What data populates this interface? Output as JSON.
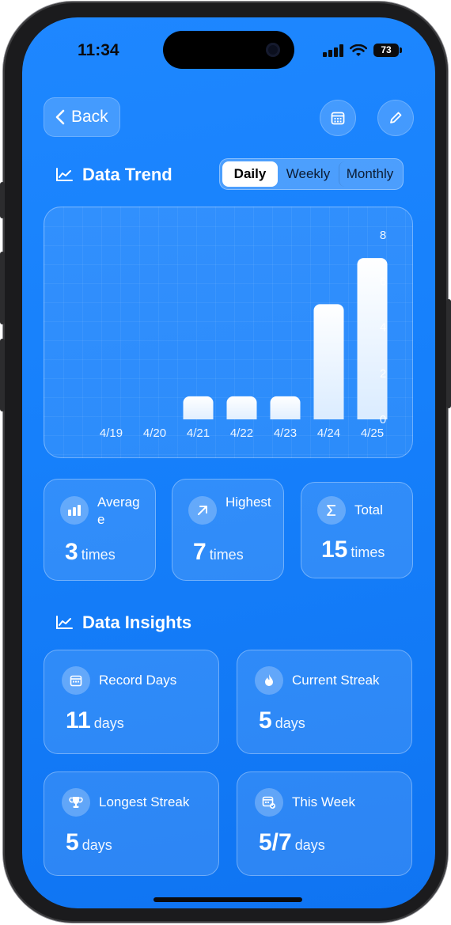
{
  "status_bar": {
    "time": "11:34",
    "battery": "73"
  },
  "header": {
    "back_label": "Back",
    "calendar_icon": "calendar-icon",
    "edit_icon": "pencil-icon"
  },
  "trend": {
    "title": "Data Trend",
    "tabs": [
      {
        "label": "Daily",
        "active": true
      },
      {
        "label": "Weekly",
        "active": false
      },
      {
        "label": "Monthly",
        "active": false
      }
    ]
  },
  "chart_data": {
    "type": "bar",
    "categories": [
      "4/19",
      "4/20",
      "4/21",
      "4/22",
      "4/23",
      "4/24",
      "4/25"
    ],
    "values": [
      0,
      0,
      1,
      1,
      1,
      5,
      7
    ],
    "ylim": [
      0,
      8
    ],
    "yticks": [
      "8",
      "6",
      "4",
      "2",
      "0"
    ],
    "y_axis_position": "right",
    "grid": true
  },
  "stats": [
    {
      "label": "Average",
      "value": "3",
      "unit": "times",
      "icon": "bar-chart-icon"
    },
    {
      "label": "Highest",
      "value": "7",
      "unit": "times",
      "icon": "arrow-up-right-icon"
    },
    {
      "label": "Total",
      "value": "15",
      "unit": "times",
      "icon": "sigma-icon"
    }
  ],
  "insights": {
    "title": "Data Insights",
    "cards": [
      {
        "label": "Record Days",
        "value": "11",
        "unit": "days",
        "icon": "calendar-icon"
      },
      {
        "label": "Current Streak",
        "value": "5",
        "unit": "days",
        "icon": "flame-icon"
      },
      {
        "label": "Longest Streak",
        "value": "5",
        "unit": "days",
        "icon": "trophy-icon"
      },
      {
        "label": "This Week",
        "value": "5/7",
        "unit": "days",
        "icon": "calendar-check-icon"
      }
    ]
  },
  "colors": {
    "background": "#1680fb",
    "accent": "#ffffff"
  }
}
